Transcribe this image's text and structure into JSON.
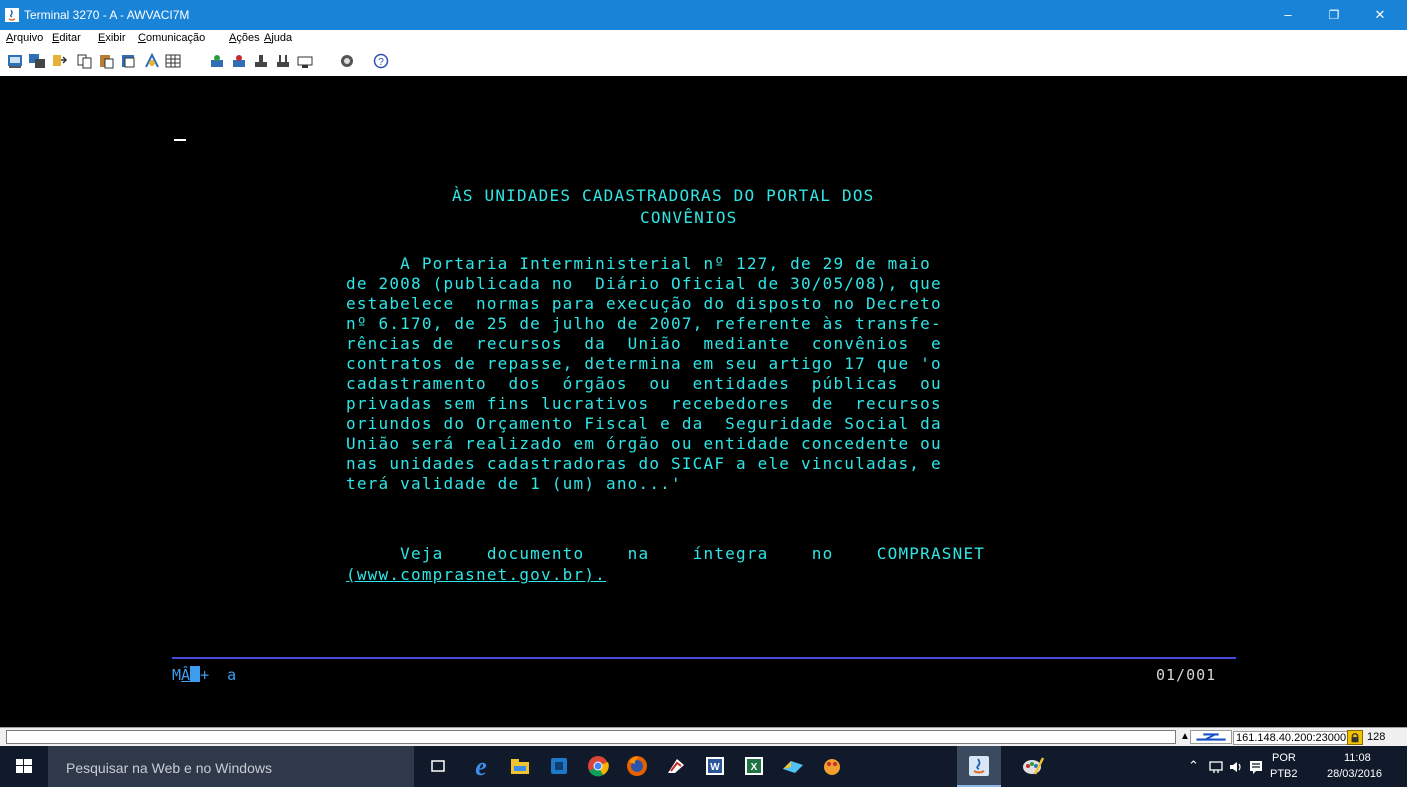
{
  "window": {
    "title": "Terminal 3270 - A - AWVACI7M",
    "controls": {
      "minimize": "–",
      "maximize": "❐",
      "close": "✕"
    }
  },
  "menu": {
    "items": [
      {
        "key": "A",
        "rest": "rquivo"
      },
      {
        "key": "E",
        "rest": "ditar"
      },
      {
        "key": "E",
        "rest": "xibir"
      },
      {
        "key": "C",
        "rest": "omunicação"
      },
      {
        "key": "A",
        "rest": "ções"
      },
      {
        "key": "A",
        "rest": "juda"
      }
    ]
  },
  "toolbar": {
    "icons": [
      "print-screen-icon",
      "copy-screen-icon",
      "receive-file-icon",
      "copy-icon",
      "paste-icon",
      "paste-special-icon",
      "settings-icon",
      "grid-icon",
      "macro-record-icon",
      "macro-play-icon",
      "upload-icon",
      "download-icon",
      "keyboard-icon",
      "disconnect-icon",
      "help-icon"
    ]
  },
  "terminal": {
    "heading_1": "ÀS UNIDADES CADASTRADORAS DO PORTAL DOS",
    "heading_2": "CONVÊNIOS",
    "paragraph": [
      "     A Portaria Interministerial nº 127, de 29 de maio",
      "de 2008 (publicada no  Diário Oficial de 30/05/08), que",
      "estabelece  normas para execução do disposto no Decreto",
      "nº 6.170, de 25 de julho de 2007, referente às transfe-",
      "rências de  recursos  da  União  mediante  convênios  e",
      "contratos de repasse, determina em seu artigo 17 que 'o",
      "cadastramento  dos  órgãos  ou  entidades  públicas  ou",
      "privadas sem fins lucrativos  recebedores  de  recursos",
      "oriundos do Orçamento Fiscal e da  Seguridade Social da",
      "União será realizado em órgão ou entidade concedente ou",
      "nas unidades cadastradoras do SICAF a ele vinculadas, e",
      "terá validade de 1 (um) ano...'"
    ],
    "link_line_1": "     Veja    documento    na    íntegra    no    COMPRASNET",
    "link_line_2": "(www.comprasnet.gov.br).",
    "oia_prefix": "M",
    "oia_lock": "Â",
    "oia_after": "+  a",
    "page_indicator": "01/001"
  },
  "status": {
    "host": "161.148.40.200:23000",
    "count": "128"
  },
  "taskbar": {
    "search_placeholder": "Pesquisar na Web e no Windows",
    "apps": [
      "task-view-icon",
      "edge-icon",
      "file-explorer-icon",
      "media-icon",
      "chrome-icon",
      "firefox-icon",
      "app-icon",
      "word-icon",
      "excel-icon",
      "app2-icon",
      "app3-icon",
      "java-terminal-icon",
      "paint-icon"
    ],
    "lang_1": "POR",
    "lang_2": "PTB2",
    "time": "11:08",
    "date": "28/03/2016",
    "colors": {
      "active_accent": "#8fb7e8",
      "background": "#101a2a"
    }
  }
}
